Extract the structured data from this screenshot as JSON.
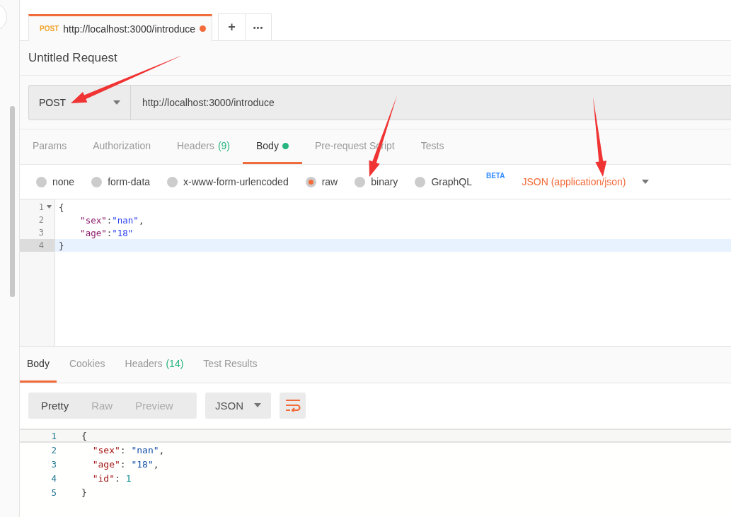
{
  "request_tab": {
    "method": "POST",
    "url": "http://localhost:3000/introduce",
    "unsaved": true,
    "selected": true
  },
  "new_tab_button": "+",
  "more_button": "•••",
  "request_title": "Untitled Request",
  "method_select": {
    "value": "POST"
  },
  "url_field": {
    "value": "http://localhost:3000/introduce"
  },
  "request_tabs": [
    {
      "label": "Params",
      "selected": false
    },
    {
      "label": "Authorization",
      "selected": false
    },
    {
      "label": "Headers",
      "count": "(9)",
      "selected": false
    },
    {
      "label": "Body",
      "modified": true,
      "selected": true
    },
    {
      "label": "Pre-request Script",
      "selected": false
    },
    {
      "label": "Tests",
      "selected": false
    }
  ],
  "body_types": [
    {
      "label": "none",
      "selected": false
    },
    {
      "label": "form-data",
      "selected": false
    },
    {
      "label": "x-www-form-urlencoded",
      "selected": false
    },
    {
      "label": "raw",
      "selected": true
    },
    {
      "label": "binary",
      "selected": false
    },
    {
      "label": "GraphQL",
      "badge": "BETA",
      "selected": false
    }
  ],
  "content_type": {
    "value": "JSON (application/json)"
  },
  "request_editor": {
    "lines": [
      {
        "number": "1",
        "foldable": true,
        "active": false,
        "tokens": [
          {
            "kind": "punct",
            "text": "{"
          }
        ]
      },
      {
        "number": "2",
        "foldable": false,
        "active": false,
        "tokens": [
          {
            "kind": "key",
            "text": "    \"sex\""
          },
          {
            "kind": "punct",
            "text": ":"
          },
          {
            "kind": "string",
            "text": "\"nan\""
          },
          {
            "kind": "punct",
            "text": ","
          }
        ]
      },
      {
        "number": "3",
        "foldable": false,
        "active": false,
        "tokens": [
          {
            "kind": "key",
            "text": "    \"age\""
          },
          {
            "kind": "punct",
            "text": ":"
          },
          {
            "kind": "string",
            "text": "\"18\""
          }
        ]
      },
      {
        "number": "4",
        "foldable": false,
        "active": true,
        "tokens": [
          {
            "kind": "punct",
            "text": "}"
          }
        ]
      }
    ]
  },
  "response_tabs": [
    {
      "label": "Body",
      "selected": true
    },
    {
      "label": "Cookies",
      "selected": false
    },
    {
      "label": "Headers",
      "count": "(14)",
      "selected": false
    },
    {
      "label": "Test Results",
      "selected": false
    }
  ],
  "view_modes": [
    {
      "label": "Pretty",
      "selected": true
    },
    {
      "label": "Raw",
      "selected": false
    },
    {
      "label": "Preview",
      "selected": false
    }
  ],
  "format_select": {
    "value": "JSON"
  },
  "wrap_lines": true,
  "response_body": {
    "lines": [
      {
        "number": "1",
        "active": true,
        "tokens": [
          {
            "kind": "bracket",
            "text": "{"
          }
        ]
      },
      {
        "number": "2",
        "active": false,
        "tokens": [
          {
            "kind": "key",
            "text": "  \"sex\""
          },
          {
            "kind": "punct",
            "text": ": "
          },
          {
            "kind": "string",
            "text": "\"nan\""
          },
          {
            "kind": "punct",
            "text": ","
          }
        ]
      },
      {
        "number": "3",
        "active": false,
        "tokens": [
          {
            "kind": "key",
            "text": "  \"age\""
          },
          {
            "kind": "punct",
            "text": ": "
          },
          {
            "kind": "string",
            "text": "\"18\""
          },
          {
            "kind": "punct",
            "text": ","
          }
        ]
      },
      {
        "number": "4",
        "active": false,
        "tokens": [
          {
            "kind": "key",
            "text": "  \"id\""
          },
          {
            "kind": "punct",
            "text": ": "
          },
          {
            "kind": "number",
            "text": "1"
          }
        ]
      },
      {
        "number": "5",
        "active": false,
        "tokens": [
          {
            "kind": "bracket",
            "text": "}"
          }
        ]
      }
    ]
  }
}
